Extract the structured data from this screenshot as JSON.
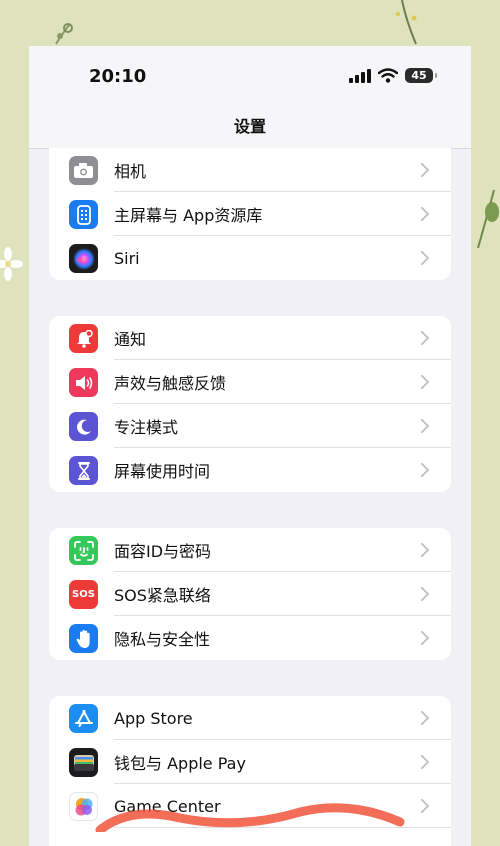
{
  "status_bar": {
    "time": "20:10",
    "battery": "45"
  },
  "nav": {
    "title": "设置"
  },
  "groups": [
    {
      "items": [
        {
          "label": "相机",
          "icon": "camera-icon",
          "color": "#8e8e93"
        },
        {
          "label": "主屏幕与 App资源库",
          "icon": "home-screen-icon",
          "color": "#1a7cf0"
        },
        {
          "label": "Siri",
          "icon": "siri-icon",
          "color": "#1c1c1e"
        }
      ]
    },
    {
      "items": [
        {
          "label": "通知",
          "icon": "bell-icon",
          "color": "#f03a3a"
        },
        {
          "label": "声效与触感反馈",
          "icon": "speaker-icon",
          "color": "#f0385c"
        },
        {
          "label": "专注模式",
          "icon": "moon-icon",
          "color": "#5b55d6"
        },
        {
          "label": "屏幕使用时间",
          "icon": "hourglass-icon",
          "color": "#5b55d6"
        }
      ]
    },
    {
      "items": [
        {
          "label": "面容ID与密码",
          "icon": "face-id-icon",
          "color": "#34c759"
        },
        {
          "label": "SOS紧急联络",
          "icon": "sos-icon",
          "color": "#ef3a37",
          "badge": "SOS"
        },
        {
          "label": "隐私与安全性",
          "icon": "hand-icon",
          "color": "#1a7cf0"
        }
      ]
    },
    {
      "items": [
        {
          "label": "App Store",
          "icon": "app-store-icon",
          "color": "#1c8ef2"
        },
        {
          "label": "钱包与 Apple Pay",
          "icon": "wallet-icon",
          "color": "#1c1c1e"
        },
        {
          "label": "Game Center",
          "icon": "game-center-icon",
          "color": "#ffffff"
        }
      ]
    }
  ]
}
